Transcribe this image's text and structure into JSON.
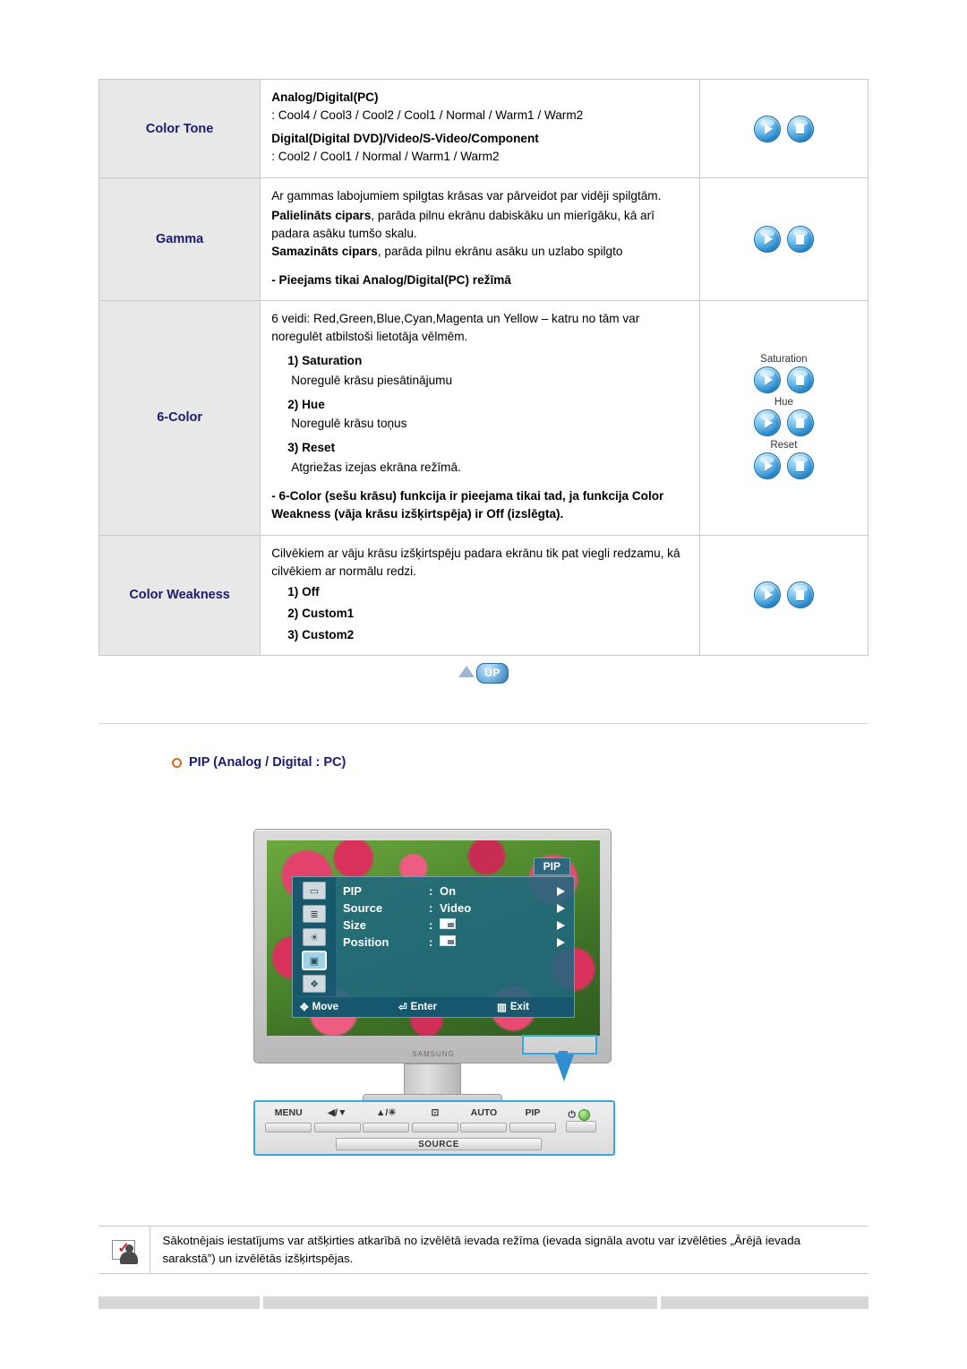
{
  "table": {
    "rows": [
      {
        "label": "Color Tone",
        "lines": [
          {
            "type": "bold",
            "text": "Analog/Digital(PC)"
          },
          {
            "type": "plain",
            "text": ": Cool4 / Cool3 / Cool2 / Cool1 / Normal / Warm1 / Warm2"
          },
          {
            "type": "bold",
            "text": "Digital(Digital DVD)/Video/S-Video/Component"
          },
          {
            "type": "plain",
            "text": ": Cool2 / Cool1 / Normal / Warm1 / Warm2"
          }
        ]
      },
      {
        "label": "Gamma",
        "lines": [
          {
            "type": "plain",
            "text": "Ar gammas labojumiem spilgtas krāsas var pārveidot par vidēji spilgtām."
          },
          {
            "type": "mixed",
            "bold": "Palielināts cipars",
            "rest": ", parāda pilnu ekrānu dabiskāku un mierīgāku, kā arī padara asāku tumšo skalu."
          },
          {
            "type": "mixed",
            "bold": "Samazināts cipars",
            "rest": ", parāda pilnu ekrānu asāku un uzlabo spilgto"
          },
          {
            "type": "note",
            "text": "- Pieejams tikai Analog/Digital(PC) režīmā"
          }
        ]
      },
      {
        "label": "6-Color",
        "lines": [
          {
            "type": "plain",
            "text": "6 veidi: Red,Green,Blue,Cyan,Magenta un Yellow – katru no tām var noregulēt atbilstoši lietotāja vēlmēm."
          },
          {
            "type": "numbered",
            "text": "1) Saturation"
          },
          {
            "type": "sub",
            "text": "Noregulē krāsu piesātinājumu"
          },
          {
            "type": "numbered",
            "text": "2) Hue"
          },
          {
            "type": "sub",
            "text": "Noregulē krāsu toņus"
          },
          {
            "type": "numbered",
            "text": "3) Reset"
          },
          {
            "type": "sub",
            "text": "Atgriežas izejas ekrāna režīmā."
          },
          {
            "type": "note",
            "text": "- 6-Color (sešu krāsu) funkcija ir pieejama tikai tad, ja funkcija Color Weakness (vāja krāsu izšķirtspēja) ir Off (izslēgta)."
          }
        ],
        "button_groups": [
          {
            "label": "Saturation"
          },
          {
            "label": "Hue"
          },
          {
            "label": "Reset"
          }
        ]
      },
      {
        "label": "Color Weakness",
        "lines": [
          {
            "type": "plain",
            "text": "Cilvēkiem ar vāju krāsu izšķirtspēju padara ekrānu tik pat viegli redzamu, kā cilvēkiem ar normālu redzi."
          },
          {
            "type": "listline",
            "text": "1) Off"
          },
          {
            "type": "listline",
            "text": "2) Custom1"
          },
          {
            "type": "listline",
            "text": "3) Custom2"
          }
        ]
      }
    ]
  },
  "up_button": {
    "label": "UP"
  },
  "pip_heading": {
    "text": "PIP (Analog / Digital : PC)"
  },
  "osd": {
    "title": "PIP",
    "rows": [
      {
        "key": "PIP",
        "sep": ":",
        "value": "On",
        "value_type": "text"
      },
      {
        "key": "Source",
        "sep": ":",
        "value": "Video",
        "value_type": "text"
      },
      {
        "key": "Size",
        "sep": ":",
        "value": "",
        "value_type": "box"
      },
      {
        "key": "Position",
        "sep": ":",
        "value": "",
        "value_type": "box"
      }
    ],
    "footer": {
      "move": "Move",
      "enter": "Enter",
      "exit": "Exit"
    },
    "brand": "SAMSUNG"
  },
  "controls": {
    "items": [
      {
        "name": "menu",
        "label": "MENU"
      },
      {
        "name": "volume",
        "label": "◀/▼"
      },
      {
        "name": "brightness",
        "label": "▲/☀"
      },
      {
        "name": "enter",
        "label": "⊡"
      },
      {
        "name": "auto",
        "label": "AUTO"
      },
      {
        "name": "pip",
        "label": "PIP"
      }
    ],
    "source_label": "SOURCE",
    "power_label": "⏻"
  },
  "note": {
    "text": "Sākotnējais iestatījums var atšķirties atkarībā no izvēlētā ievada režīma (ievada signāla avotu var izvēlēties „Ārējā ievada sarakstā”) un izvēlētās izšķirtspējas."
  }
}
